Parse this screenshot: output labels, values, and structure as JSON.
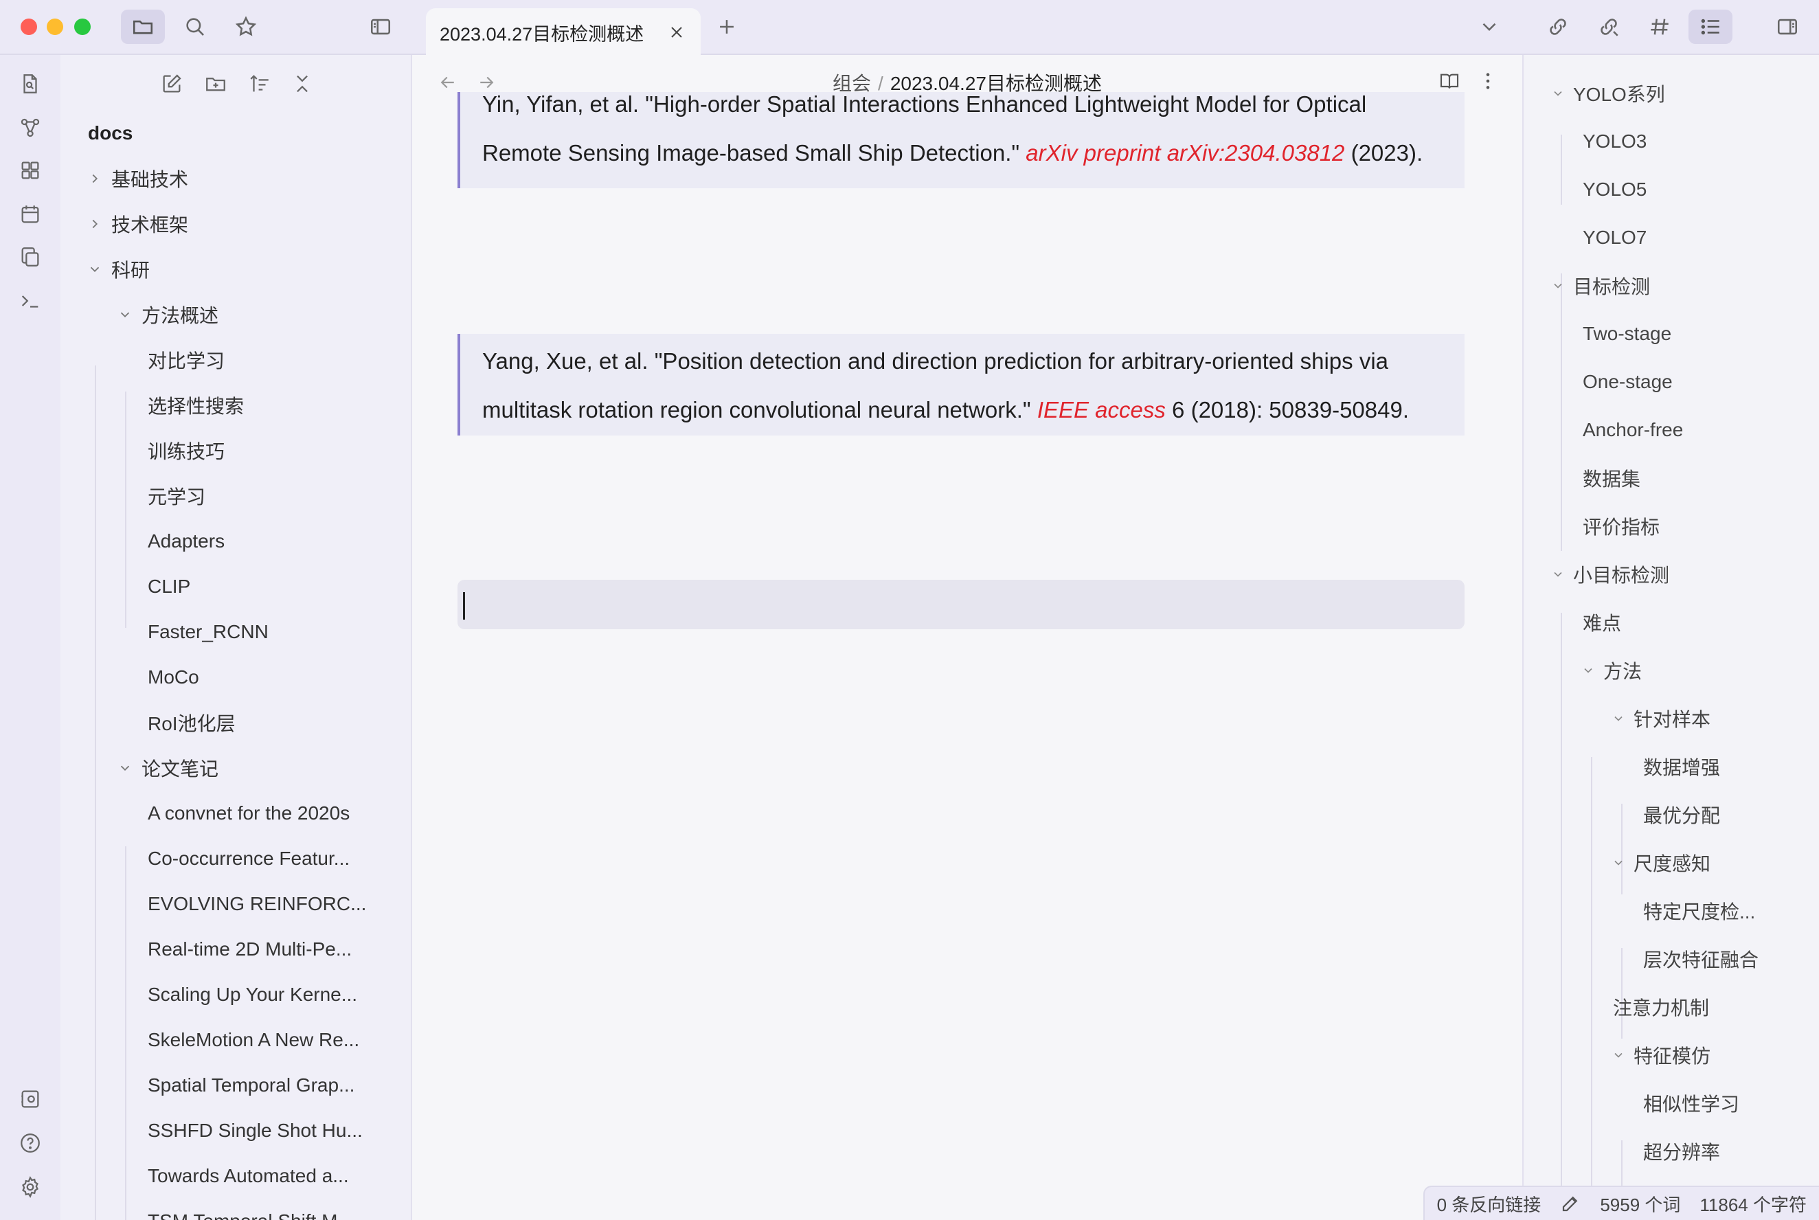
{
  "tab": {
    "title": "2023.04.27目标检测概述"
  },
  "explorer": {
    "vault_name": "docs",
    "items": [
      {
        "label": "基础技术",
        "expanded": false
      },
      {
        "label": "技术框架",
        "expanded": false
      },
      {
        "label": "科研",
        "expanded": true
      },
      {
        "label": "方法概述",
        "expanded": true
      },
      {
        "label": "对比学习"
      },
      {
        "label": "选择性搜索"
      },
      {
        "label": "训练技巧"
      },
      {
        "label": "元学习"
      },
      {
        "label": "Adapters"
      },
      {
        "label": "CLIP"
      },
      {
        "label": "Faster_RCNN"
      },
      {
        "label": "MoCo"
      },
      {
        "label": "RoI池化层"
      },
      {
        "label": "论文笔记",
        "expanded": true
      },
      {
        "label": "A convnet for the 2020s"
      },
      {
        "label": "Co-occurrence Featur..."
      },
      {
        "label": "EVOLVING REINFORC..."
      },
      {
        "label": "Real-time 2D Multi-Pe..."
      },
      {
        "label": "Scaling Up Your Kerne..."
      },
      {
        "label": "SkeleMotion A New Re..."
      },
      {
        "label": "Spatial Temporal Grap..."
      },
      {
        "label": "SSHFD Single Shot Hu..."
      },
      {
        "label": "Towards Automated a..."
      },
      {
        "label": "TSM Temporal Shift M..."
      }
    ]
  },
  "editor": {
    "breadcrumb": {
      "folder": "组会",
      "separator": "/",
      "file": "2023.04.27目标检测概述"
    },
    "quotes": [
      {
        "line1": "Yin, Yifan, et al. \"High-order Spatial Interactions Enhanced Lightweight Model for Optical",
        "line2_pre": "Remote Sensing Image-based Small Ship Detection.\" ",
        "line2_em": "arXiv preprint arXiv:2304.03812",
        "line2_post": " (2023)."
      },
      {
        "line1": "Yang, Xue, et al. \"Position detection and direction prediction for arbitrary-oriented ships via",
        "line2_pre": "multitask rotation region convolutional neural network.\" ",
        "line2_em": "IEEE access",
        "line2_post": " 6 (2018): 50839-50849."
      }
    ]
  },
  "outline": {
    "items": [
      {
        "label": "YOLO系列",
        "collapsible": true
      },
      {
        "label": "YOLO3"
      },
      {
        "label": "YOLO5"
      },
      {
        "label": "YOLO7"
      },
      {
        "label": "目标检测",
        "collapsible": true
      },
      {
        "label": "Two-stage"
      },
      {
        "label": "One-stage"
      },
      {
        "label": "Anchor-free"
      },
      {
        "label": "数据集"
      },
      {
        "label": "评价指标"
      },
      {
        "label": "小目标检测",
        "collapsible": true
      },
      {
        "label": "难点"
      },
      {
        "label": "方法",
        "collapsible": true
      },
      {
        "label": "针对样本",
        "collapsible": true
      },
      {
        "label": "数据增强"
      },
      {
        "label": "最优分配"
      },
      {
        "label": "尺度感知",
        "collapsible": true
      },
      {
        "label": "特定尺度检..."
      },
      {
        "label": "层次特征融合"
      },
      {
        "label": "注意力机制"
      },
      {
        "label": "特征模仿",
        "collapsible": true
      },
      {
        "label": "相似性学习"
      },
      {
        "label": "超分辨率"
      }
    ]
  },
  "status": {
    "backlinks": "0 条反向链接",
    "words": "5959 个词",
    "chars": "11864 个字符"
  },
  "colors": {
    "accent": "#8b7fd0",
    "citation_red": "#e0242c",
    "traffic_red": "#fe5f57",
    "traffic_yellow": "#febc2e",
    "traffic_green": "#28c840"
  }
}
